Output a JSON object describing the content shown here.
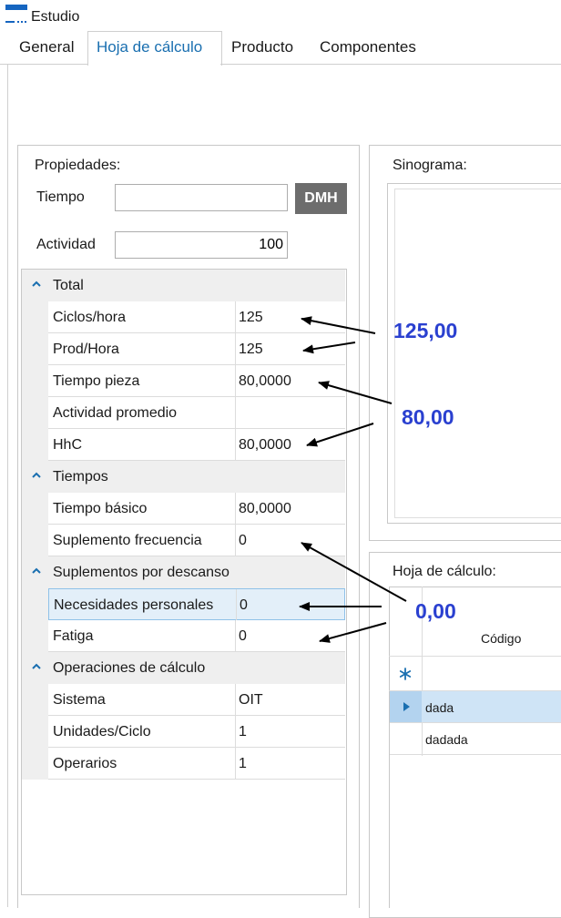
{
  "window": {
    "title": "Estudio",
    "icon": "app-window-icon"
  },
  "tabs": [
    {
      "label": "General",
      "active": false
    },
    {
      "label": "Hoja de cálculo",
      "active": true
    },
    {
      "label": "Producto",
      "active": false
    },
    {
      "label": "Componentes",
      "active": false
    }
  ],
  "properties": {
    "title": "Propiedades:",
    "tiempo_label": "Tiempo",
    "tiempo_value": "",
    "dmh_button": "DMH",
    "actividad_label": "Actividad",
    "actividad_value": "100"
  },
  "grid": {
    "categories": [
      {
        "name": "Total",
        "rows": [
          {
            "name": "Ciclos/hora",
            "value": "125"
          },
          {
            "name": "Prod/Hora",
            "value": "125"
          },
          {
            "name": "Tiempo pieza",
            "value": "80,0000"
          },
          {
            "name": "Actividad promedio",
            "value": ""
          },
          {
            "name": "HhC",
            "value": "80,0000"
          }
        ]
      },
      {
        "name": "Tiempos",
        "rows": [
          {
            "name": "Tiempo básico",
            "value": "80,0000"
          },
          {
            "name": "Suplemento frecuencia",
            "value": "0"
          }
        ]
      },
      {
        "name": "Suplementos por descanso",
        "rows": [
          {
            "name": "Necesidades personales",
            "value": "0",
            "selected": true
          },
          {
            "name": "Fatiga",
            "value": "0"
          }
        ]
      },
      {
        "name": "Operaciones de cálculo",
        "rows": [
          {
            "name": "Sistema",
            "value": "OIT"
          },
          {
            "name": "Unidades/Ciclo",
            "value": "1"
          },
          {
            "name": "Operarios",
            "value": "1"
          }
        ]
      }
    ]
  },
  "sinograma": {
    "title": "Sinograma:"
  },
  "hoja": {
    "title": "Hoja de cálculo:",
    "column_header": "Código",
    "new_row_icon": "asterisk-icon",
    "rows": [
      {
        "code": "dada",
        "selected": true
      },
      {
        "code": "dadada",
        "selected": false
      }
    ]
  },
  "annotations": [
    {
      "text": "125,00"
    },
    {
      "text": "80,00"
    },
    {
      "text": "0,00"
    }
  ],
  "colors": {
    "annotation": "#2a40d0",
    "selection": "#e3eff9",
    "dmh_bg": "#6d6d6d"
  }
}
